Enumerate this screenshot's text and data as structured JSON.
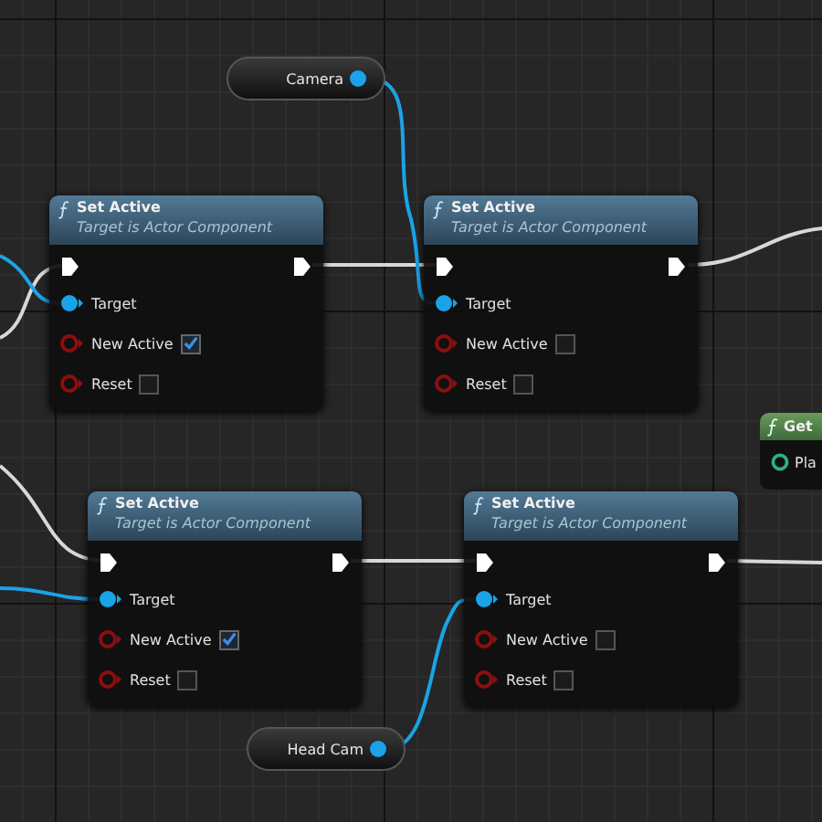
{
  "variables": [
    {
      "label": "Camera"
    },
    {
      "label": "Head Cam"
    }
  ],
  "function_nodes": [
    {
      "title": "Set Active",
      "subtitle": "Target is Actor Component",
      "pins": [
        {
          "kind": "object",
          "label": "Target"
        },
        {
          "kind": "bool",
          "label": "New Active",
          "checked": true
        },
        {
          "kind": "bool",
          "label": "Reset",
          "checked": false
        }
      ]
    },
    {
      "title": "Set Active",
      "subtitle": "Target is Actor Component",
      "pins": [
        {
          "kind": "object",
          "label": "Target"
        },
        {
          "kind": "bool",
          "label": "New Active",
          "checked": false
        },
        {
          "kind": "bool",
          "label": "Reset",
          "checked": false
        }
      ]
    },
    {
      "title": "Set Active",
      "subtitle": "Target is Actor Component",
      "pins": [
        {
          "kind": "object",
          "label": "Target"
        },
        {
          "kind": "bool",
          "label": "New Active",
          "checked": true
        },
        {
          "kind": "bool",
          "label": "Reset",
          "checked": false
        }
      ]
    },
    {
      "title": "Set Active",
      "subtitle": "Target is Actor Component",
      "pins": [
        {
          "kind": "object",
          "label": "Target"
        },
        {
          "kind": "bool",
          "label": "New Active",
          "checked": false
        },
        {
          "kind": "bool",
          "label": "Reset",
          "checked": false
        }
      ]
    }
  ],
  "get_node": {
    "title": "Get",
    "pin": "Pla"
  }
}
